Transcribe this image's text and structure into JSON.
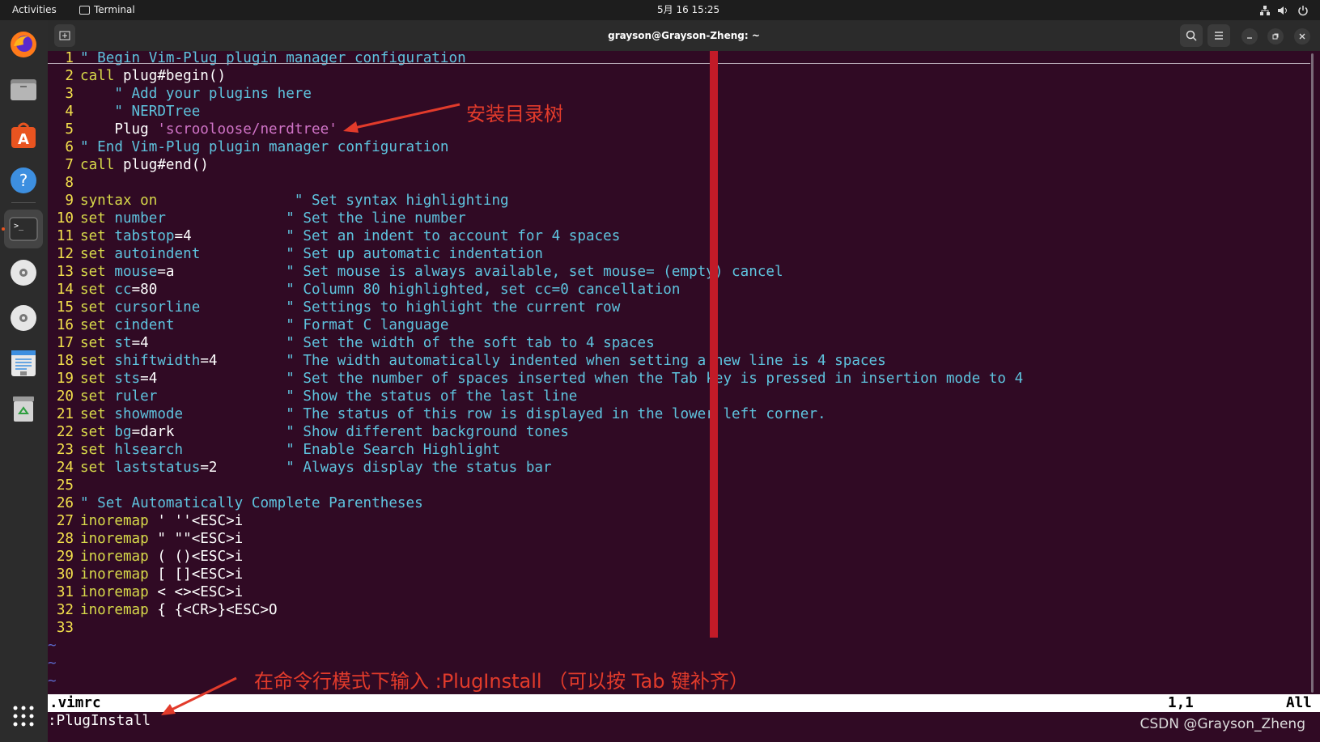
{
  "topbar": {
    "activities": "Activities",
    "app": "Terminal",
    "clock": "5月 16 15:25"
  },
  "window": {
    "title": "grayson@Grayson-Zheng: ~"
  },
  "dock": {
    "items": [
      "firefox-icon",
      "files-icon",
      "software-icon",
      "help-icon",
      "terminal-icon",
      "disc-icon",
      "disc-icon",
      "text-editor-icon",
      "trash-icon"
    ]
  },
  "editor": {
    "lines": [
      [
        {
          "t": "\" Begin Vim-Plug plugin manager configuration",
          "c": "cm"
        }
      ],
      [
        {
          "t": "call",
          "c": "kw"
        },
        {
          "t": " plug#begin()",
          "c": "nm"
        }
      ],
      [
        {
          "t": "    \" Add your plugins here",
          "c": "cm"
        }
      ],
      [
        {
          "t": "    \" NERDTree",
          "c": "cm"
        }
      ],
      [
        {
          "t": "    Plug ",
          "c": "nm"
        },
        {
          "t": "'scrooloose/nerdtree'",
          "c": "st"
        }
      ],
      [
        {
          "t": "\" End Vim-Plug plugin manager configuration",
          "c": "cm"
        }
      ],
      [
        {
          "t": "call",
          "c": "kw"
        },
        {
          "t": " plug#end()",
          "c": "nm"
        }
      ],
      [],
      [
        {
          "t": "syntax",
          "c": "kw"
        },
        {
          "t": " ",
          "c": "nm"
        },
        {
          "t": "on",
          "c": "kw"
        },
        {
          "t": "                ",
          "c": "nm"
        },
        {
          "t": "\" Set syntax highlighting",
          "c": "cm"
        }
      ],
      [
        {
          "t": "set",
          "c": "kw"
        },
        {
          "t": " ",
          "c": "nm"
        },
        {
          "t": "number",
          "c": "cm"
        },
        {
          "t": "              ",
          "c": "nm"
        },
        {
          "t": "\" Set the line number",
          "c": "cm"
        }
      ],
      [
        {
          "t": "set",
          "c": "kw"
        },
        {
          "t": " ",
          "c": "nm"
        },
        {
          "t": "tabstop",
          "c": "cm"
        },
        {
          "t": "=4           ",
          "c": "nm"
        },
        {
          "t": "\" Set an indent to account for 4 spaces",
          "c": "cm"
        }
      ],
      [
        {
          "t": "set",
          "c": "kw"
        },
        {
          "t": " ",
          "c": "nm"
        },
        {
          "t": "autoindent",
          "c": "cm"
        },
        {
          "t": "          ",
          "c": "nm"
        },
        {
          "t": "\" Set up automatic indentation",
          "c": "cm"
        }
      ],
      [
        {
          "t": "set",
          "c": "kw"
        },
        {
          "t": " ",
          "c": "nm"
        },
        {
          "t": "mouse",
          "c": "cm"
        },
        {
          "t": "=a             ",
          "c": "nm"
        },
        {
          "t": "\" Set mouse is always available, set mouse= (empty) cancel",
          "c": "cm"
        }
      ],
      [
        {
          "t": "set",
          "c": "kw"
        },
        {
          "t": " ",
          "c": "nm"
        },
        {
          "t": "cc",
          "c": "cm"
        },
        {
          "t": "=80               ",
          "c": "nm"
        },
        {
          "t": "\" Column 80 highlighted, set cc=0 cancellation",
          "c": "cm"
        }
      ],
      [
        {
          "t": "set",
          "c": "kw"
        },
        {
          "t": " ",
          "c": "nm"
        },
        {
          "t": "cursorline",
          "c": "cm"
        },
        {
          "t": "          ",
          "c": "nm"
        },
        {
          "t": "\" Settings to highlight the current row",
          "c": "cm"
        }
      ],
      [
        {
          "t": "set",
          "c": "kw"
        },
        {
          "t": " ",
          "c": "nm"
        },
        {
          "t": "cindent",
          "c": "cm"
        },
        {
          "t": "             ",
          "c": "nm"
        },
        {
          "t": "\" Format C language",
          "c": "cm"
        }
      ],
      [
        {
          "t": "set",
          "c": "kw"
        },
        {
          "t": " ",
          "c": "nm"
        },
        {
          "t": "st",
          "c": "cm"
        },
        {
          "t": "=4                ",
          "c": "nm"
        },
        {
          "t": "\" Set the width of the soft tab to 4 spaces",
          "c": "cm"
        }
      ],
      [
        {
          "t": "set",
          "c": "kw"
        },
        {
          "t": " ",
          "c": "nm"
        },
        {
          "t": "shiftwidth",
          "c": "cm"
        },
        {
          "t": "=4        ",
          "c": "nm"
        },
        {
          "t": "\" The width automatically indented when setting a new line is 4 spaces",
          "c": "cm"
        }
      ],
      [
        {
          "t": "set",
          "c": "kw"
        },
        {
          "t": " ",
          "c": "nm"
        },
        {
          "t": "sts",
          "c": "cm"
        },
        {
          "t": "=4               ",
          "c": "nm"
        },
        {
          "t": "\" Set the number of spaces inserted when the Tab key is pressed in insertion mode to 4",
          "c": "cm"
        }
      ],
      [
        {
          "t": "set",
          "c": "kw"
        },
        {
          "t": " ",
          "c": "nm"
        },
        {
          "t": "ruler",
          "c": "cm"
        },
        {
          "t": "               ",
          "c": "nm"
        },
        {
          "t": "\" Show the status of the last line",
          "c": "cm"
        }
      ],
      [
        {
          "t": "set",
          "c": "kw"
        },
        {
          "t": " ",
          "c": "nm"
        },
        {
          "t": "showmode",
          "c": "cm"
        },
        {
          "t": "            ",
          "c": "nm"
        },
        {
          "t": "\" The status of this row is displayed in the lower left corner.",
          "c": "cm"
        }
      ],
      [
        {
          "t": "set",
          "c": "kw"
        },
        {
          "t": " ",
          "c": "nm"
        },
        {
          "t": "bg",
          "c": "cm"
        },
        {
          "t": "=dark             ",
          "c": "nm"
        },
        {
          "t": "\" Show different background tones",
          "c": "cm"
        }
      ],
      [
        {
          "t": "set",
          "c": "kw"
        },
        {
          "t": " ",
          "c": "nm"
        },
        {
          "t": "hlsearch",
          "c": "cm"
        },
        {
          "t": "            ",
          "c": "nm"
        },
        {
          "t": "\" Enable Search Highlight",
          "c": "cm"
        }
      ],
      [
        {
          "t": "set",
          "c": "kw"
        },
        {
          "t": " ",
          "c": "nm"
        },
        {
          "t": "laststatus",
          "c": "cm"
        },
        {
          "t": "=2        ",
          "c": "nm"
        },
        {
          "t": "\" Always display the status bar",
          "c": "cm"
        }
      ],
      [],
      [
        {
          "t": "\" Set Automatically Complete Parentheses",
          "c": "cm"
        }
      ],
      [
        {
          "t": "inoremap",
          "c": "kw"
        },
        {
          "t": " ' ''<ESC>i",
          "c": "nm"
        }
      ],
      [
        {
          "t": "inoremap",
          "c": "kw"
        },
        {
          "t": " \" \"\"<ESC>i",
          "c": "nm"
        }
      ],
      [
        {
          "t": "inoremap",
          "c": "kw"
        },
        {
          "t": " ( ()<ESC>i",
          "c": "nm"
        }
      ],
      [
        {
          "t": "inoremap",
          "c": "kw"
        },
        {
          "t": " [ []<ESC>i",
          "c": "nm"
        }
      ],
      [
        {
          "t": "inoremap",
          "c": "kw"
        },
        {
          "t": " < <><ESC>i",
          "c": "nm"
        }
      ],
      [
        {
          "t": "inoremap",
          "c": "kw"
        },
        {
          "t": " { {<CR>}<ESC>O",
          "c": "nm"
        }
      ],
      []
    ],
    "tildes": [
      "~",
      "~",
      "~"
    ]
  },
  "statusbar": {
    "filename": ".vimrc",
    "position": "1,1",
    "scroll": "All"
  },
  "cmdline": ":PlugInstall",
  "annotations": {
    "top": "安装目录树",
    "bottom": "在命令行模式下输入 :PlugInstall （可以按 Tab 键补齐）"
  },
  "watermark": "CSDN @Grayson_Zheng",
  "colors": {
    "cc_column": "#c21b28",
    "annotation": "#e23b2b"
  }
}
